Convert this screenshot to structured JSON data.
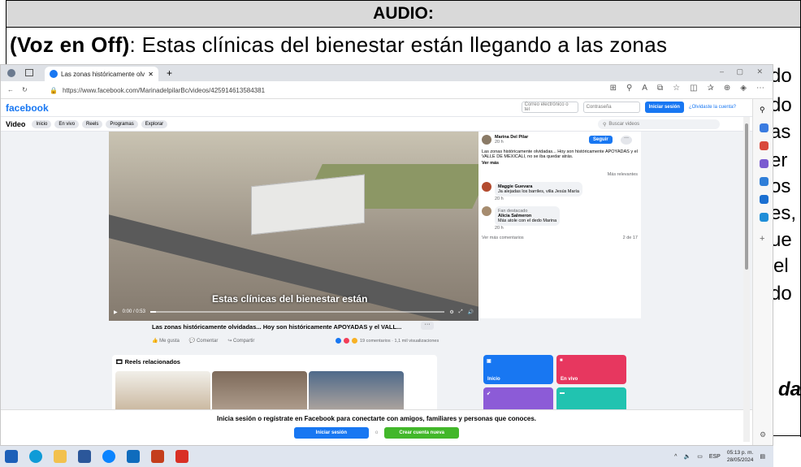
{
  "document": {
    "header": "AUDIO:",
    "line1_bold": "(Voz en Off)",
    "line1_text": ": Estas clínicas del bienestar están llegando a las zonas",
    "right_fragments": [
      "do",
      "do",
      "as",
      "er",
      "os",
      "es,",
      "ue",
      "el",
      "do"
    ],
    "italic_fragment": "da"
  },
  "browser": {
    "tab_title": "Las zonas históricamente olvidada",
    "url": "https://www.facebook.com/MarinadelpilarBc/videos/425914613584381",
    "fb": {
      "logo": "facebook",
      "email_placeholder": "Correo electrónico o tel",
      "password_placeholder": "Contraseña",
      "login_button": "Iniciar sesión",
      "forgot_link": "¿Olvidaste la cuenta?"
    },
    "video_nav": {
      "title": "Video",
      "items": [
        "Inicio",
        "En vivo",
        "Reels",
        "Programas",
        "Explorar"
      ],
      "search_placeholder": "Buscar videos"
    },
    "player": {
      "caption": "Estas clínicas del bienestar están",
      "time": "0:00 / 0:53",
      "progress": 0.02
    },
    "video_title": "Las zonas históricamente olvidadas... Hoy son históricamente APOYADAS y el VALL...",
    "actions": [
      "Me gusta",
      "Comentar",
      "Compartir"
    ],
    "stats": "19 comentarios · 1,1 mil visualizaciones",
    "post": {
      "author": "Marina Del Pilar",
      "time": "20 h",
      "follow": "Seguir",
      "text": "Las zonas históricamente olvidadas... Hoy son históricamente APOYADAS y el VALLE DE MEXICALI, no se iba quedar atrás.",
      "see_more": "Ver más",
      "sort": "Más relevantes"
    },
    "comments": [
      {
        "name": "Maggie Guevara",
        "text": "Ja alejadas los barriles, villa Jesús María",
        "time": "20 h"
      },
      {
        "name": "Alicia Salmeron",
        "badge": "Fan destacado",
        "text": "Más atole con el dedo Marina",
        "time": "20 h"
      }
    ],
    "more_comments": "Ver más comentarios",
    "comment_count": "2 de 17",
    "reels_title": "Reels relacionados",
    "tiles": [
      {
        "label": "Inicio",
        "color": "#e7375f"
      },
      {
        "label": "En vivo",
        "color": "#e7375f"
      }
    ],
    "tiles_blue": "#1877f2",
    "tiles_purple": "#8c5bd7",
    "tiles_teal": "#21c3b0",
    "banner_text": "Inicia sesión o regístrate en Facebook para conectarte con amigos, familiares y personas que conoces.",
    "banner_login": "Iniciar sesión",
    "banner_or": "o",
    "banner_create": "Crear cuenta nueva"
  },
  "taskbar": {
    "lang": "ESP",
    "time": "05:13 p. m.",
    "date": "28/05/2024"
  }
}
